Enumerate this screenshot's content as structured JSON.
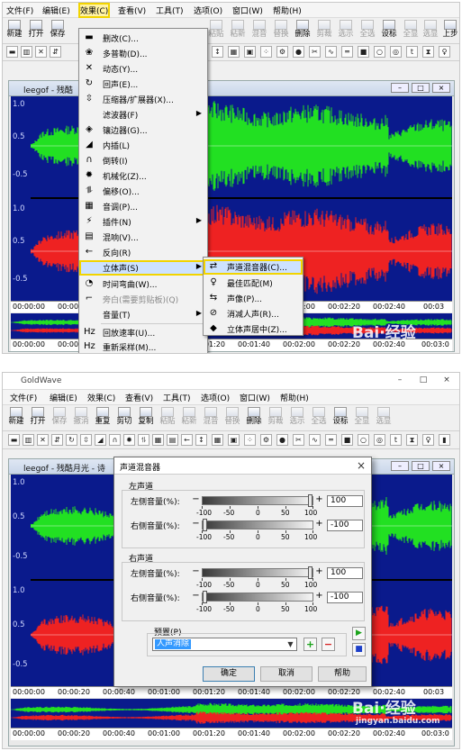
{
  "app": {
    "title": "GoldWave"
  },
  "menubar": [
    "文件(F)",
    "编辑(E)",
    "效果(C)",
    "查看(V)",
    "工具(T)",
    "选项(O)",
    "窗口(W)",
    "帮助(H)"
  ],
  "toolbar": [
    "新建",
    "打开",
    "保存",
    "撤消",
    "重复",
    "剪切",
    "复制",
    "粘贴",
    "粘新",
    "混音",
    "替换",
    "删除",
    "剪裁",
    "选示",
    "全选",
    "设标",
    "全显",
    "选显",
    "上步"
  ],
  "doc": {
    "title1": "leegof - 残酷",
    "title2": "leegof - 残酷月光 - 诗",
    "buttons": [
      "–",
      "□",
      "×"
    ]
  },
  "wave": {
    "axis": [
      "1.0",
      "0.5",
      "-0.5",
      "1.0",
      "0.5",
      "-0.5"
    ],
    "timeline": [
      "00:00:00",
      "00:00:20",
      "00:00:40",
      "00:01:00",
      "00:01:20",
      "00:01:40",
      "00:02:00",
      "00:02:20",
      "00:02:40",
      "00:03"
    ],
    "overview": [
      "00:00:00",
      "00:00:20",
      "00:00:40",
      "00:01:00",
      "00:01:20",
      "00:01:40",
      "00:02:00",
      "00:02:20",
      "00:02:40",
      "00:03:0"
    ],
    "colors": {
      "background": "#0a1a8c",
      "left": "#22e022",
      "right": "#ee2222"
    }
  },
  "effects_menu": [
    {
      "icon": "flatten-icon",
      "label": "删改(C)..."
    },
    {
      "icon": "echo-multi-icon",
      "label": "多普勒(D)..."
    },
    {
      "icon": "dynamics-icon",
      "label": "动态(Y)..."
    },
    {
      "icon": "echo-icon",
      "label": "回声(E)..."
    },
    {
      "icon": "compressor-icon",
      "label": "压缩器/扩展器(X)..."
    },
    {
      "icon": "filter-icon",
      "label": "滤波器(F)",
      "submenu": true
    },
    {
      "icon": "limiter-icon",
      "label": "镶边器(G)..."
    },
    {
      "icon": "fade-in-icon",
      "label": "内插(L)"
    },
    {
      "icon": "invert-icon",
      "label": "倒转(I)"
    },
    {
      "icon": "mechanize-icon",
      "label": "机械化(Z)..."
    },
    {
      "icon": "offset-icon",
      "label": "偏移(O)..."
    },
    {
      "icon": "pitch-icon",
      "label": "音调(P)..."
    },
    {
      "icon": "plugin-icon",
      "label": "插件(N)",
      "submenu": true
    },
    {
      "icon": "reverb-icon",
      "label": "混响(V)..."
    },
    {
      "icon": "reverse-icon",
      "label": "反向(R)"
    },
    {
      "icon": "stereo-icon",
      "label": "立体声(S)",
      "submenu": true,
      "selected": true
    },
    {
      "icon": "time-warp-icon",
      "label": "时间弯曲(W)..."
    },
    {
      "icon": "sidechain-icon",
      "label": "旁白(需要剪贴板)(Q)",
      "disabled": true
    },
    {
      "icon": "volume-icon",
      "label": "音量(T)",
      "submenu": true
    },
    {
      "icon": "playback-rate-icon",
      "label": "回放速率(U)..."
    },
    {
      "icon": "resample-icon",
      "label": "重新采样(M)..."
    }
  ],
  "stereo_submenu": [
    {
      "icon": "channel-mixer-icon",
      "label": "声道混音器(C)...",
      "selected": true
    },
    {
      "icon": "match-icon",
      "label": "最佳匹配(M)"
    },
    {
      "icon": "pan-icon",
      "label": "声像(P)..."
    },
    {
      "icon": "vocal-remove-icon",
      "label": "消减人声(R)..."
    },
    {
      "icon": "center-icon",
      "label": "立体声居中(Z)..."
    }
  ],
  "dialog": {
    "title": "声道混音器",
    "close": "×",
    "left_group": "左声道",
    "right_group": "右声道",
    "left_volume_label": "左侧音量(%):",
    "right_volume_label": "右侧音量(%):",
    "ticks": [
      "-100",
      "-50",
      "0",
      "50",
      "100"
    ],
    "left_channel": {
      "left_volume": "100",
      "right_volume": "-100",
      "left_level": 1.0,
      "right_level": -1.0
    },
    "right_channel": {
      "left_volume": "100",
      "right_volume": "-100",
      "left_level": 1.0,
      "right_level": -1.0
    },
    "preset_label": "预置(P)",
    "preset_value": "人声消除",
    "ok": "确定",
    "cancel": "取消",
    "help": "帮助"
  },
  "watermark": {
    "logo": "Bai·经验",
    "url": "jingyan.baidu.com"
  }
}
